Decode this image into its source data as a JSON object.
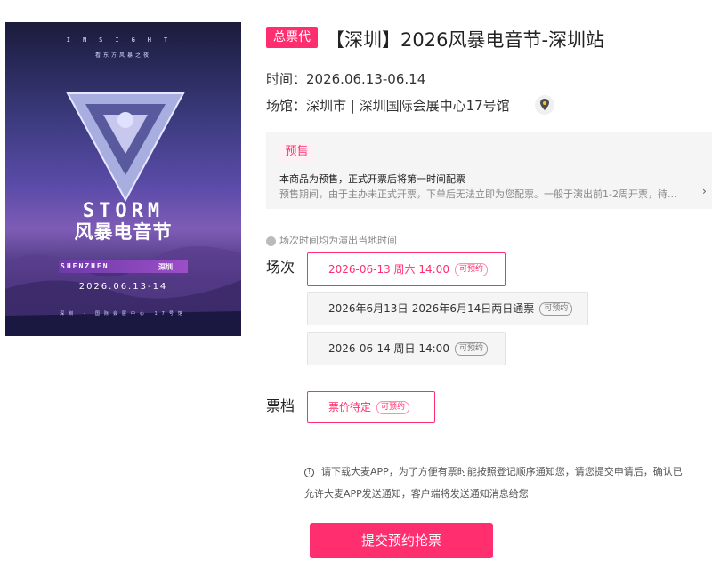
{
  "poster": {
    "brand": "INSIGHT",
    "tagline": "看东方风暴之夜",
    "logo_en": "STORM",
    "logo_cn": "风暴电音节",
    "city_en": "SHENZHEN",
    "city_cn": "深圳",
    "date": "2026.06.13-14",
    "venue_line": "深圳 · 国际会展中心 17号馆"
  },
  "header": {
    "badge": "总票代",
    "title": "【深圳】2026风暴电音节-深圳站"
  },
  "info": {
    "time": "时间：2026.06.13-06.14",
    "venue": "场馆：深圳市 | 深圳国际会展中心17号馆"
  },
  "presale": {
    "tag": "预售",
    "line1": "本商品为预售，正式开票后将第一时间配票",
    "line2": "预售期间，由于主办未正式开票，下单后无法立即为您配票。一般于演出前1-2周开票，待..."
  },
  "timezone_note": "场次时间均为演出当地时间",
  "sessions": {
    "label": "场次",
    "options": [
      {
        "text": "2026-06-13 周六 14:00",
        "tag": "可预约"
      },
      {
        "text": "2026年6月13日-2026年6月14日两日通票",
        "tag": "可预约"
      },
      {
        "text": "2026-06-14 周日 14:00",
        "tag": "可预约"
      }
    ]
  },
  "tiers": {
    "label": "票档",
    "options": [
      {
        "text": "票价待定",
        "tag": "可预约"
      }
    ]
  },
  "notice": {
    "line1": "请下载大麦APP，为了方便有票时能按照登记顺序通知您，请您提交申请后，确认已",
    "line2": "允许大麦APP发送通知，客户端将发送通知消息给您"
  },
  "submit_label": "提交预约抢票",
  "colors": {
    "accent": "#ff2e6f",
    "presale_bg": "#f5f5f5"
  }
}
